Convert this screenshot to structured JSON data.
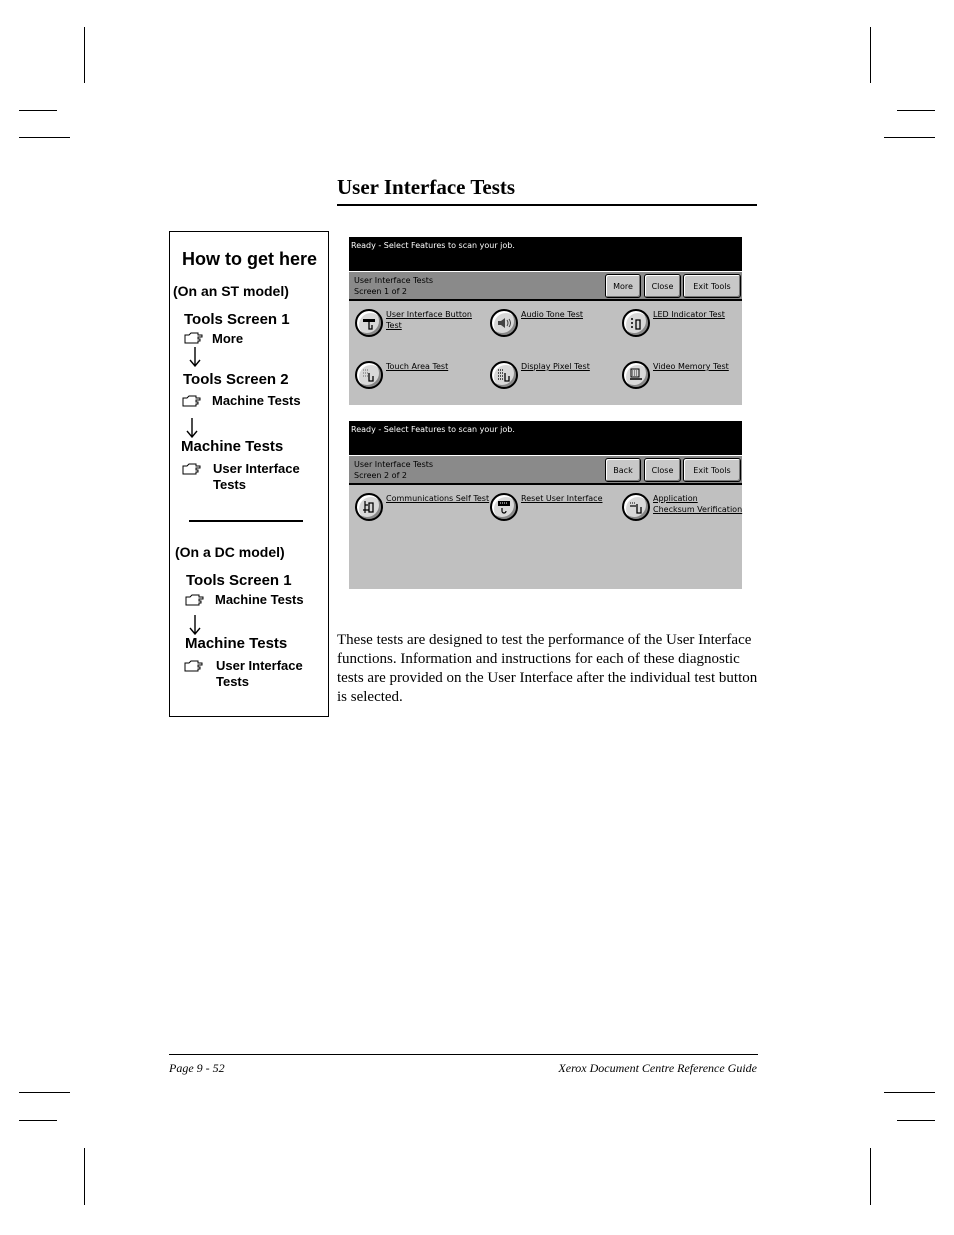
{
  "page": {
    "title": "User Interface Tests",
    "body_text": "These tests are designed to test the performance of the User Interface functions. Information and instructions for each of these diagnostic tests are provided on the User Interface after the individual test button is selected.",
    "footer": {
      "left": "Page 9 - 52",
      "right": "Xerox Document Centre Reference Guide"
    }
  },
  "nav_box": {
    "heading": "How to get here",
    "st_model": {
      "label": "(On an ST model)",
      "steps": [
        {
          "screen": "Tools Screen 1",
          "action": "More"
        },
        {
          "screen": "Tools Screen 2",
          "action": "Machine Tests"
        },
        {
          "screen": "Machine Tests",
          "action_line1": "User Interface",
          "action_line2": "Tests"
        }
      ]
    },
    "dc_model": {
      "label": "(On a DC model)",
      "steps": [
        {
          "screen": "Tools Screen 1",
          "action": "Machine Tests"
        },
        {
          "screen": "Machine Tests",
          "action_line1": "User Interface",
          "action_line2": "Tests"
        }
      ]
    }
  },
  "screens": [
    {
      "status": "Ready -  Select Features to scan your job.",
      "title": "User Interface Tests",
      "subtitle": "Screen 1 of 2",
      "buttons": [
        "More",
        "Close",
        "Exit Tools"
      ],
      "items": [
        {
          "line1": "User Interface Button",
          "line2": "Test",
          "icon": "keypad-touch-icon"
        },
        {
          "line1": "Audio Tone Test",
          "line2": "",
          "icon": "speaker-icon"
        },
        {
          "line1": "LED Indicator Test",
          "line2": "",
          "icon": "led-touch-icon"
        },
        {
          "line1": "Touch Area Test",
          "line2": "",
          "icon": "touch-area-icon"
        },
        {
          "line1": "Display Pixel Test",
          "line2": "",
          "icon": "pixel-grid-icon"
        },
        {
          "line1": "Video Memory Test",
          "line2": "",
          "icon": "memory-icon"
        }
      ]
    },
    {
      "status": "Ready -  Select Features to scan your job.",
      "title": "User Interface Tests",
      "subtitle": "Screen 2 of 2",
      "buttons": [
        "Back",
        "Close",
        "Exit Tools"
      ],
      "items": [
        {
          "line1": "Communications Self Test",
          "line2": "",
          "icon": "comms-touch-icon"
        },
        {
          "line1": "Reset User Interface",
          "line2": "",
          "icon": "reset-icon"
        },
        {
          "line1": "Application",
          "line2": "Checksum Verification",
          "icon": "checksum-icon"
        }
      ]
    }
  ]
}
